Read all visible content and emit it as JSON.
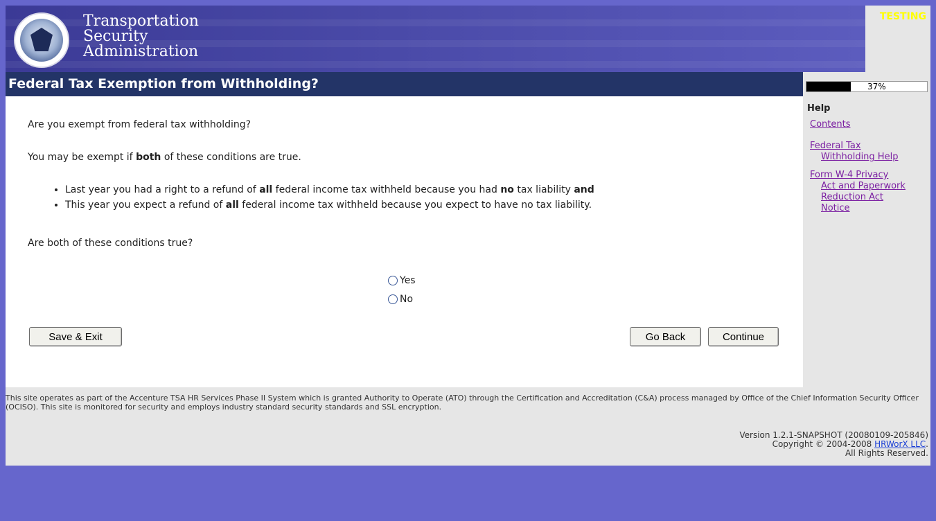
{
  "header": {
    "agency_lines": [
      "Transportation",
      "Security",
      "Administration"
    ],
    "environment_badge": "TESTING",
    "colors": {
      "banner": "#4a4aa8",
      "badge": "#ffff00"
    }
  },
  "page": {
    "title": "Federal Tax Exemption from Withholding?",
    "progress_text": "37%",
    "progress_value": 0.37
  },
  "main": {
    "question": "Are you exempt from federal tax withholding?",
    "intro_prefix": "You may be exempt if ",
    "intro_bold": "both",
    "intro_suffix": " of these conditions are true.",
    "condition1": {
      "a": "Last year you had a right to a refund of ",
      "b1": "all",
      "c": " federal income tax withheld because you had ",
      "b2": "no",
      "d": " tax liability ",
      "b3": "and"
    },
    "condition2": {
      "a": "This year you expect a refund of ",
      "b1": "all",
      "c": " federal income tax withheld because you expect to have no tax liability."
    },
    "confirm_question": "Are both of these conditions true?",
    "options": [
      "Yes",
      "No"
    ]
  },
  "buttons": {
    "save_exit": "Save & Exit",
    "go_back": "Go Back",
    "continue": "Continue"
  },
  "help": {
    "title": "Help",
    "contents": "Contents",
    "fed_line1": "Federal Tax",
    "fed_line2": "Withholding Help",
    "form_line1": "Form W-4 Privacy",
    "form_line2": "Act and Paperwork",
    "form_line3": "Reduction Act",
    "form_line4": "Notice"
  },
  "footer": {
    "disclaimer": "This site operates as part of the Accenture TSA HR Services Phase II System which is granted Authority to Operate (ATO) through the Certification and Accreditation (C&A) process managed by Office of the Chief Information Security Officer (OCISO). This site is monitored for security and employs industry standard security standards and SSL encryption.",
    "version": "Version 1.2.1-SNAPSHOT (20080109-205846)",
    "copyright_prefix": "Copyright © 2004-2008 ",
    "copyright_link": "HRWorX LLC",
    "copyright_suffix": ".",
    "rights": "All Rights Reserved."
  }
}
